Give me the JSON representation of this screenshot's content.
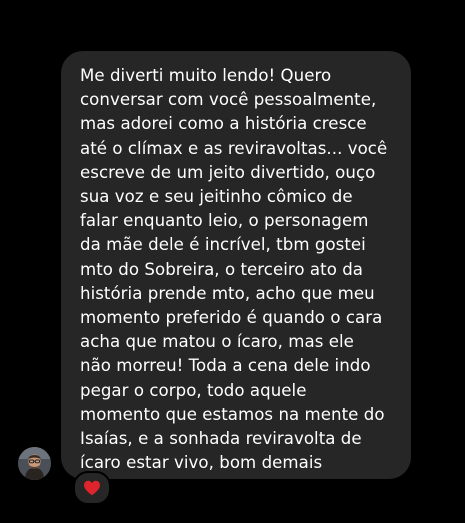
{
  "theme": {
    "background": "#000000",
    "bubble_color": "#262626",
    "text_color": "#ffffff",
    "reaction_color": "#e0242d"
  },
  "message": {
    "lines": [
      "Me diverti muito lendo! Quero",
      "conversar com você pessoalmente,",
      "mas adorei como a história cresce",
      "até o clímax e as reviravoltas... você",
      "escreve de um jeito divertido, ouço",
      "sua voz e seu jeitinho cômico de",
      "falar enquanto leio, o personagem",
      "da mãe dele é incrível, tbm gostei",
      "mto do Sobreira, o terceiro ato da",
      "história prende mto, acho que meu",
      "momento preferido é quando o cara",
      "acha que matou o ícaro, mas ele",
      "não morreu! Toda a cena dele indo",
      "pegar o corpo, todo aquele",
      "momento que estamos na mente do",
      "Isaías, e a sonhada reviravolta de",
      "ícaro estar vivo, bom demais"
    ]
  },
  "sender": {
    "avatar_icon": "user-avatar"
  },
  "reaction": {
    "icon": "heart-icon"
  }
}
